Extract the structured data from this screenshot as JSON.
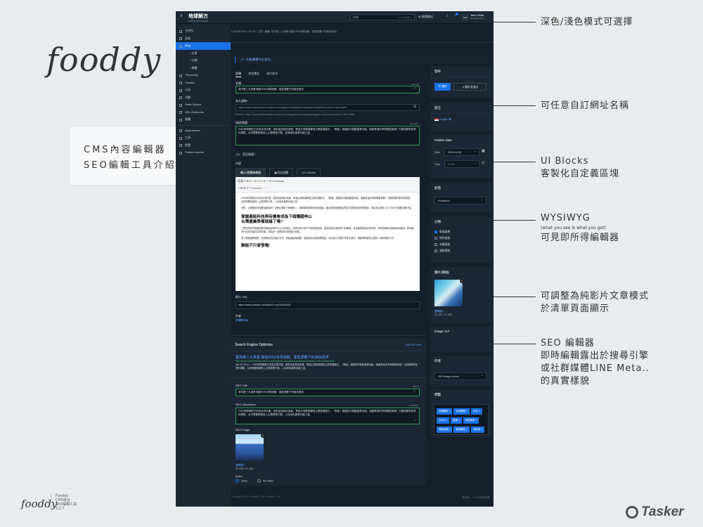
{
  "slide": {
    "logo": "fooddy",
    "callout_line1": "CMS內容編輯器",
    "callout_line2": "SEO編輯工具介紹",
    "footer_logo": "fooddy",
    "footer_meta": [
      "Fooddy",
      "CMS後台",
      "SEO編輯工具",
      "3.2.7"
    ],
    "tasker": "Tasker"
  },
  "annotations": {
    "dark_mode": "深色/淺色模式可選擇",
    "custom_url": "可任意自訂網址名稱",
    "ui_blocks_title": "UI Blocks",
    "ui_blocks_desc": "客製化自定義區塊",
    "wysiwyg_title": "WYSIWYG",
    "wysiwyg_small": "(what you see is what you get)",
    "wysiwyg_desc": "可見即所得編輯器",
    "video_line1": "可調整為純影片文章模式",
    "video_line2": "於清單頁面顯示",
    "seo_line1": "SEO 編輯器",
    "seo_line2": "即時編輯露出於搜尋引擎",
    "seo_line3": "或社群媒體LINE Meta..",
    "seo_line4": "的真實樣貌"
  },
  "app": {
    "brand": "地球解方",
    "brand_sub": "EARTH SOLUTIONS",
    "search_placeholder": "搜尋",
    "search_hint": "Ctrl+K 快速搜尋",
    "top_link": "查看網站",
    "user_avatar": "Tech",
    "user_name": "Tech Geek",
    "user_email": "tech@fooddy.tw",
    "nav": [
      {
        "label": "主控台",
        "active": false,
        "sub": false
      },
      {
        "label": "頁面",
        "active": false,
        "sub": false
      },
      {
        "label": "Blog",
        "active": true,
        "sub": false
      },
      {
        "label": "文章",
        "active": false,
        "sub": true
      },
      {
        "label": "分類",
        "active": false,
        "sub": true
      },
      {
        "label": "標籤",
        "active": false,
        "sub": true
      },
      {
        "label": "Themeday",
        "active": false,
        "sub": false
      },
      {
        "label": "Solution",
        "active": false,
        "sub": false
      },
      {
        "label": "公告",
        "active": false,
        "sub": false
      },
      {
        "label": "活動",
        "active": false,
        "sub": false
      },
      {
        "label": "Static Blocks",
        "active": false,
        "sub": false
      },
      {
        "label": "URL Redirector",
        "active": false,
        "sub": false
      },
      {
        "label": "媒體",
        "active": false,
        "sub": false
      },
      {
        "label": "Appearance",
        "active": false,
        "sub": false
      },
      {
        "label": "工具",
        "active": false,
        "sub": false
      },
      {
        "label": "設置",
        "active": false,
        "sub": false
      },
      {
        "label": "Platform admin",
        "active": false,
        "sub": false
      }
    ],
    "breadcrumb": "DASHBOARD  /  BLOG  /  文章  /  編輯 \"臺灣第三大事業 聯誼2050淨零挑戰，重能源賽下的綠色經濟\"",
    "back_link": "⟵ 文章(繁體中文/英文)",
    "tabs": [
      "詳情",
      "其他筆記",
      "修訂版本"
    ],
    "name_label": "名稱",
    "name_count": "(26/250)",
    "name_value": "臺灣第三大事業 聯誼2050淨零挑戰，重能源賽下的綠色經濟",
    "permalink_label": "永久連結*",
    "permalink_value": "https://www.earthsolutions-action.com/blog/new-educational-program-empowers-youth-in-tech-skills",
    "permalink_preview": "Preview: https://www.earthsolutions-action.com/blog/new-educational-program-empowers-youth-in-tech-skills",
    "summary_label": "描述/摘要",
    "summary_count": "(129/400)",
    "summary_value": "2050淨零轉型已成為全球共識，面對這波綠色浪潮，業者必須積極轉型企業營運模式。「聯能」蘊藏如何推動產業永續，讓產業達成淨零轉型新機？行動與應對各界的課題，台灣需要積極投入企業轉型行動，促進綠色產業永續之道。",
    "featured_label": "是否精選?",
    "content_label": "內容",
    "editor_tabs": [
      "顯示/隱藏編輯器",
      "添加媒體",
      "UI Blocks"
    ],
    "toolbar_row1": "段落  ≡  ⊞  A  ⌐  B  I  U  S  ¶  ⌁  ⊡  UI Blocks",
    "toolbar_row2": "≡  ⊞  ⊟  ↶  ↷  Source  ⋯",
    "body_p1": "2050淨零轉型已成為全球共識，面對這波綠色浪潮，業者必須積極轉型企業營運模式。「聯能」蘊藏如何推動產業永續，讓產業達成淨零轉型新機？行動與應對各界的課題，台灣需要積極投入企業轉型行動，以及綠色產業永續之道。",
    "body_p2": "然而，企業要如何因應這股潮流？其實企業除了積極投入，更需要找到新的成長動能。聯合國永續發展目標正在重塑全球商業格局，而台灣企業在 2024 年也已展開具體行動。",
    "body_h1": "掌握產能科技與有機會成為下個護國神山",
    "body_h2": "台灣產業準備就緒了嗎?",
    "body_p3": "工業技術研究院產業經濟與趨勢研究中心分析指出，淨零排放已經不只是環保議題，而是攸關企業競爭力的關鍵。台灣產業若能及早布局，掌握低碳科技與綠色供應鏈，將有機會在全球市場中搶得先機，成為新一波經濟成長的動力來源。",
    "body_p4": "為了推動產業轉型，政府與民間正攜手合作，從能源結構調整、製程改善到碳管理制度，逐步建立完整的淨零生態系，期望帶動更多企業投入綠色轉型行列。",
    "body_h3": "聯能不只會發電!",
    "video_label": "影片 URL",
    "video_value": "https://www.youtube.com/watch?v=yCh9Dh2lSU",
    "author_label": "作者",
    "author_value": "請選擇作者",
    "seo_title": "Search Engine Optimize",
    "seo_edit": "Edit SEO meta",
    "seo_preview_title": "臺灣第三大事業 聯誼2050淨零挑戰，重能源賽下的綠色經濟",
    "seo_preview_url": "https://www.earthsolutions-action.com/blog/new-educational-program-empowers-youth-in-tech-skills",
    "seo_preview_desc": "Apr 05, 2024 — 2050淨零轉型已成為全球共識，面對這波綠色浪潮，業者必須積極轉型企業營運模式。「聯能」蘊藏如何推動產業永續，讓產業達成淨零轉型新機？行動與應對各界的課題，台灣需要積極投入企業轉型行動，以及綠色產業永續之道。",
    "seo_title_label": "SEO Title",
    "seo_title_count": "(26/70)",
    "seo_title_value": "臺灣第三大事業 聯誼2050淨零挑戰，重能源賽下的綠色經濟",
    "seo_desc_label": "SEO description",
    "seo_desc_count": "(129/160)",
    "seo_desc_value": "2050淨零轉型已成為全球共識，面對這波綠色浪潮，業者必須積極轉型企業營運模式。「聯能」蘊藏如何推動產業永續，讓產業達成淨零轉型新機？行動與應對各界的課題，台灣需要積極投入企業轉型行動，以及綠色產業永續之道。",
    "seo_image_label": "SEO image",
    "seo_image_choose": "選擇圖片",
    "seo_image_url": "或 添加 URL 圖片",
    "index_label": "Index",
    "index_opt1": "Index",
    "index_opt2": "No index",
    "copyright": "Copyright 2024 © Fooddy CMS. Version 7.4.0",
    "page_loaded": "頁面載入 0.23 秒完成處理",
    "publish_title": "發布",
    "save_btn": "儲存",
    "save_exit_btn": "儲存並退出",
    "language_title": "語言",
    "language_value": "English",
    "publish_date_title": "Publish date",
    "date_label": "Date",
    "date_value": "2024-04-05",
    "time_label": "Time",
    "time_value": "14:00",
    "status_title": "狀態",
    "status_value": "Published",
    "category_title": "分類",
    "categories": [
      {
        "label": "氣候變遷",
        "checked": true
      },
      {
        "label": "綠色能源",
        "checked": false
      },
      {
        "label": "永續發展",
        "checked": false
      },
      {
        "label": "減碳策略",
        "checked": false
      }
    ],
    "image_title": "圖片(橫幅)",
    "image_choose": "選擇圖片",
    "image_url": "或 添加 URL 圖片",
    "image_alt_title": "Image ALT",
    "template_title": "作者",
    "template_value": "ON Design Action",
    "tags_title": "標籤",
    "tags": [
      "永續轉型 ×",
      "台灣轉型 ×",
      "ESG ×",
      "SDGs ×",
      "能源 ×",
      "綠色經濟 ×",
      "節能減碳 ×",
      "能源轉型 ×",
      "淨零碳 ×"
    ]
  }
}
